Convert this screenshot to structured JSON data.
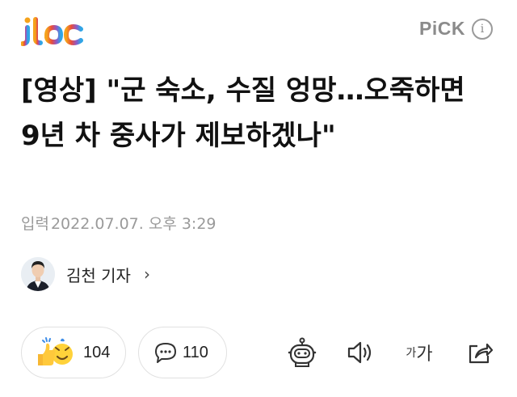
{
  "header": {
    "logo_name": "jtbc",
    "pick_label": "PiCK",
    "info_glyph": "i"
  },
  "article": {
    "title": "[영상] \"군 숙소, 수질 엉망…오죽하면 9년 차 중사가 제보하겠나\"",
    "date_label": "입력",
    "date": "2022.07.07. 오후 3:29",
    "reporter": "김천 기자",
    "reporter_chevron": "›"
  },
  "actions": {
    "reaction_count": "104",
    "comment_count": "110",
    "font_small": "가",
    "font_big": "가"
  },
  "colors": {
    "logo_gradient": [
      "#f5a21b",
      "#e94b3c",
      "#8e58c8",
      "#2fa6e6"
    ],
    "muted": "#9a9a9a",
    "border": "#e1e1e1"
  }
}
